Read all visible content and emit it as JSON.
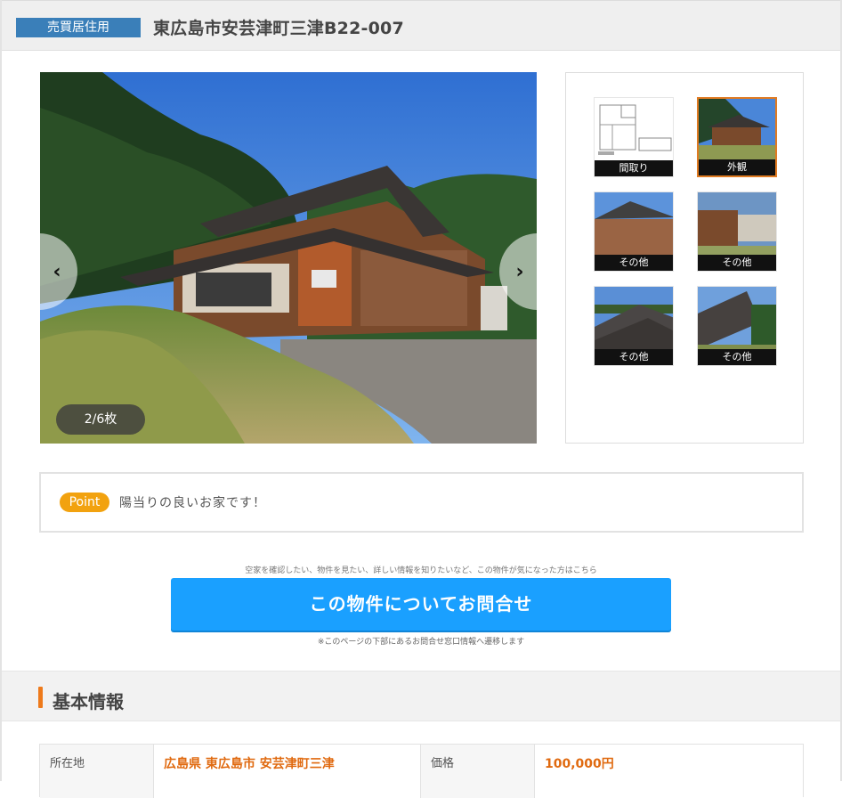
{
  "header": {
    "badge": "売買居住用",
    "title": "東広島市安芸津町三津B22-007"
  },
  "gallery": {
    "counter": "2/6枚",
    "prev_icon": "chevron-left-icon",
    "next_icon": "chevron-right-icon",
    "thumbnails": [
      {
        "label": "間取り",
        "active": false
      },
      {
        "label": "外観",
        "active": true
      },
      {
        "label": "その他",
        "active": false
      },
      {
        "label": "その他",
        "active": false
      },
      {
        "label": "その他",
        "active": false
      },
      {
        "label": "その他",
        "active": false
      }
    ]
  },
  "point": {
    "tag": "Point",
    "text": "陽当りの良いお家です！"
  },
  "cta": {
    "caption": "空家を確認したい、物件を見たい、詳しい情報を知りたいなど、この物件が気になった方はこちら",
    "button": "この物件についてお問合せ",
    "note": "※このページの下部にあるお問合せ窓口情報へ遷移します"
  },
  "basic_info": {
    "title": "基本情報",
    "rows": [
      {
        "label1": "所在地",
        "value1": "広島県 東広島市 安芸津町三津",
        "label2": "価格",
        "value2": "100,000円"
      }
    ]
  },
  "colors": {
    "badge": "#3a7fb9",
    "cta": "#1aa0ff",
    "accent": "#ee7a1b",
    "point": "#f2a20f"
  }
}
